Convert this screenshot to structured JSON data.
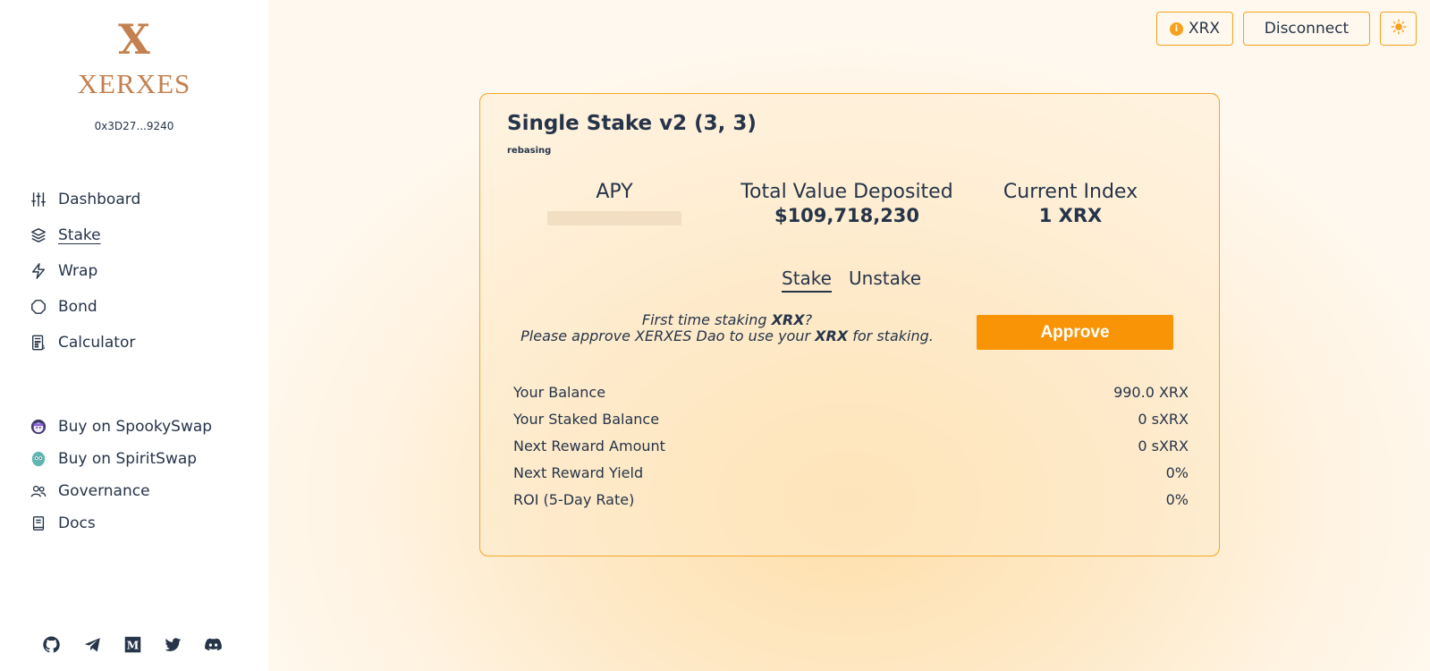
{
  "sidebar": {
    "logo_mark": "X",
    "logo_text": "XERXES",
    "wallet_address": "0x3D27...9240",
    "nav": [
      {
        "label": "Dashboard",
        "icon": "sliders-icon"
      },
      {
        "label": "Stake",
        "icon": "layers-icon"
      },
      {
        "label": "Wrap",
        "icon": "lightning-icon"
      },
      {
        "label": "Bond",
        "icon": "bond-icon"
      },
      {
        "label": "Calculator",
        "icon": "calculator-icon"
      }
    ],
    "links": [
      {
        "label": "Buy on SpookySwap",
        "icon": "spookyswap-icon"
      },
      {
        "label": "Buy on SpiritSwap",
        "icon": "spiritswap-icon"
      },
      {
        "label": "Governance",
        "icon": "people-icon"
      },
      {
        "label": "Docs",
        "icon": "book-icon"
      }
    ],
    "social": [
      "github-icon",
      "telegram-icon",
      "medium-icon",
      "twitter-icon",
      "discord-icon"
    ]
  },
  "header": {
    "token_label": "XRX",
    "disconnect_label": "Disconnect",
    "theme_icon": "sun-icon"
  },
  "stake_card": {
    "title": "Single Stake v2 (3, 3)",
    "subtitle": "rebasing",
    "metrics": {
      "apy_label": "APY",
      "tvd_label": "Total Value Deposited",
      "tvd_value": "$109,718,230",
      "index_label": "Current Index",
      "index_value": "1 XRX"
    },
    "tabs": [
      "Stake",
      "Unstake"
    ],
    "approve": {
      "line1_prefix": "First time staking ",
      "line1_token": "XRX",
      "line1_suffix": "?",
      "line2_prefix": "Please approve XERXES Dao to use your ",
      "line2_token": "XRX",
      "line2_suffix": " for staking.",
      "button_label": "Approve"
    },
    "rows": [
      {
        "label": "Your Balance",
        "value": "990.0 XRX"
      },
      {
        "label": "Your Staked Balance",
        "value": "0 sXRX"
      },
      {
        "label": "Next Reward Amount",
        "value": "0 sXRX"
      },
      {
        "label": "Next Reward Yield",
        "value": "0%"
      },
      {
        "label": "ROI (5-Day Rate)",
        "value": "0%"
      }
    ]
  },
  "colors": {
    "accent": "#f89406",
    "brand": "#c4804f",
    "text": "#253449",
    "border": "#f5a623"
  }
}
